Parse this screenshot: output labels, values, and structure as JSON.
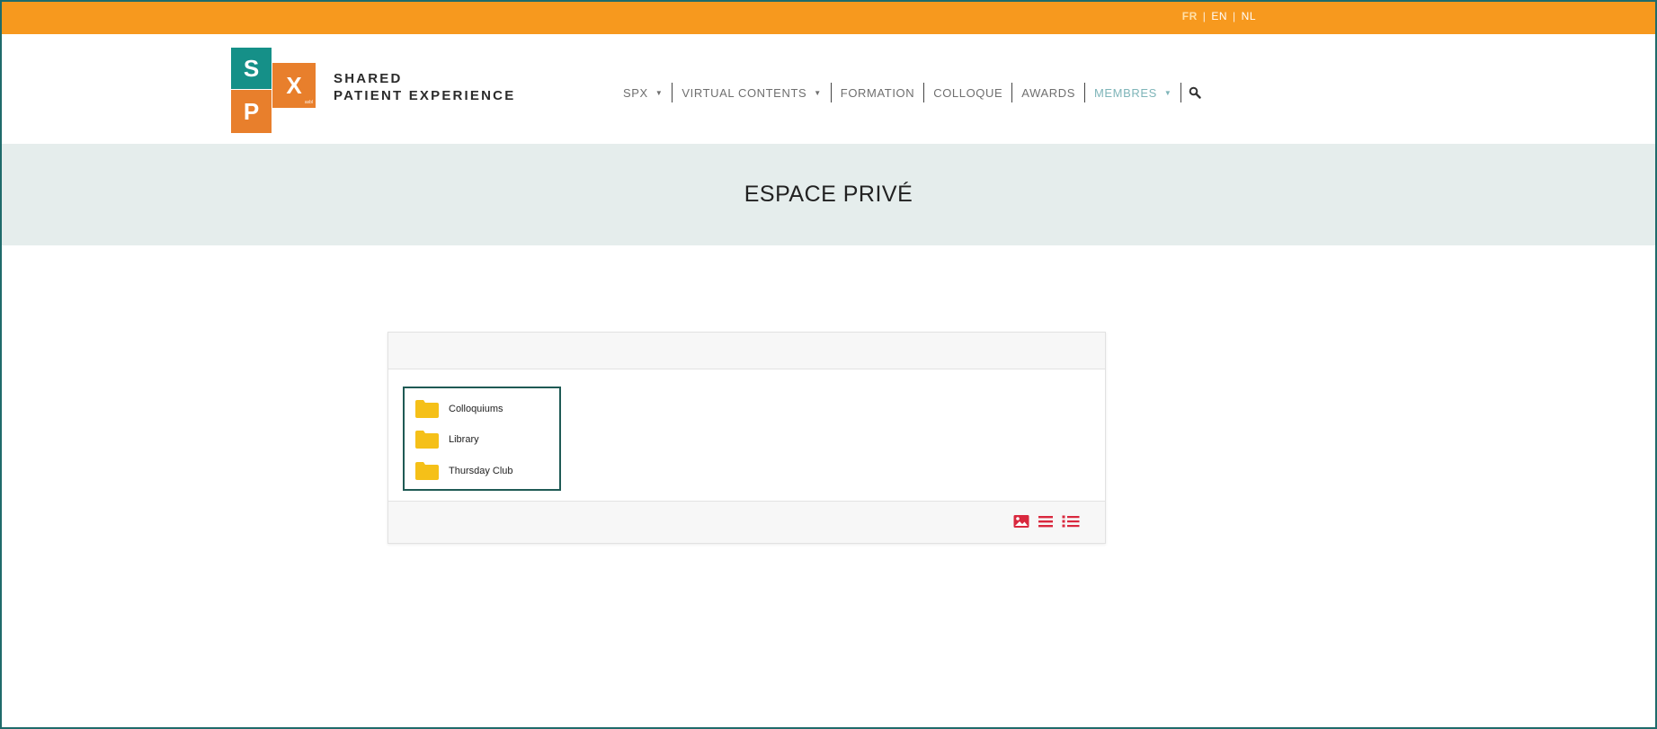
{
  "languages": [
    {
      "label": "FR",
      "active": true
    },
    {
      "label": "EN",
      "active": false
    },
    {
      "label": "NL",
      "active": false
    }
  ],
  "logo": {
    "s": "S",
    "x": "X",
    "p": "P",
    "x_sub": "asbl"
  },
  "brand": {
    "line1": "SHARED",
    "line2": "PATIENT EXPERIENCE"
  },
  "nav": {
    "spx": "SPX",
    "virtual": "VIRTUAL CONTENTS",
    "formation": "FORMATION",
    "colloque": "COLLOQUE",
    "awards": "AWARDS",
    "membres": "MEMBRES"
  },
  "page": {
    "title": "ESPACE PRIVÉ"
  },
  "folders": [
    {
      "name": "Colloquiums"
    },
    {
      "name": "Library"
    },
    {
      "name": "Thursday Club"
    }
  ],
  "colors": {
    "topbar": "#f7991e",
    "teal": "#159088",
    "orange": "#e87f2c",
    "hero": "#e5edec",
    "folder": "#f5c018",
    "view_icons": "#d9283e",
    "nav_active": "#7fb5b9"
  },
  "icons": {
    "folder": "folder-icon",
    "search": "search-icon",
    "caret": "caret-down-icon",
    "view_thumbnails": "image-icon",
    "view_list": "list-icon",
    "view_details": "bulleted-list-icon"
  }
}
